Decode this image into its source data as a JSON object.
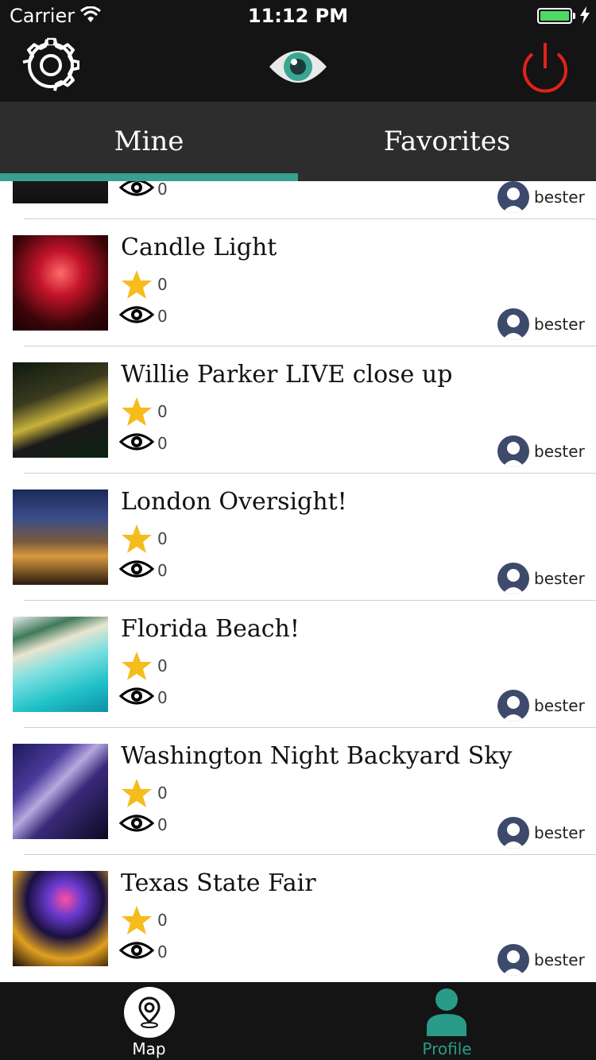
{
  "status_bar": {
    "carrier": "Carrier",
    "time": "11:12 PM"
  },
  "nav": {
    "settings_icon": "gear-icon",
    "logo_icon": "eye-icon",
    "power_icon": "power-icon",
    "colors": {
      "bar": "#141414",
      "power": "#e0221b",
      "logo": "#3aa692"
    }
  },
  "tabs": [
    {
      "label": "Mine",
      "selected": true
    },
    {
      "label": "Favorites",
      "selected": false
    }
  ],
  "accent": "#38a08f",
  "posts": [
    {
      "title": "",
      "favorites": "",
      "views": "0",
      "user": "bester",
      "thumb": "dark",
      "partial": true
    },
    {
      "title": "Candle Light",
      "favorites": "0",
      "views": "0",
      "user": "bester",
      "thumb": "candle"
    },
    {
      "title": "Willie Parker LIVE close up",
      "favorites": "0",
      "views": "0",
      "user": "bester",
      "thumb": "football"
    },
    {
      "title": "London Oversight!",
      "favorites": "0",
      "views": "0",
      "user": "bester",
      "thumb": "city"
    },
    {
      "title": "Florida Beach!",
      "favorites": "0",
      "views": "0",
      "user": "bester",
      "thumb": "beach"
    },
    {
      "title": "Washington Night Backyard Sky",
      "favorites": "0",
      "views": "0",
      "user": "bester",
      "thumb": "sky"
    },
    {
      "title": "Texas State Fair",
      "favorites": "0",
      "views": "0",
      "user": "bester",
      "thumb": "fair"
    }
  ],
  "tab_bar": {
    "map_label": "Map",
    "profile_label": "Profile",
    "profile_active": true
  }
}
